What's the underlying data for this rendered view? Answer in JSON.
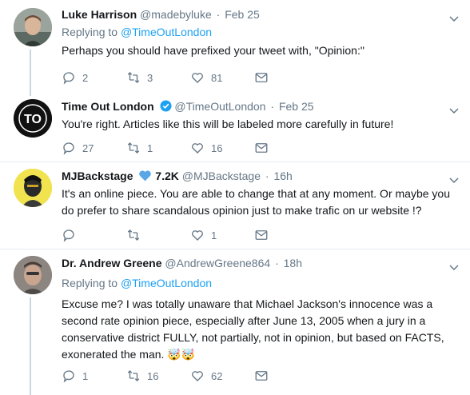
{
  "tweets": [
    {
      "name": "Luke Harrison",
      "handle": "@madebyluke",
      "time": "Feb 25",
      "replying_prefix": "Replying to",
      "replying_to": "@TimeOutLondon",
      "text": "Perhaps you should have prefixed your tweet with, \"Opinion:\"",
      "replies": "2",
      "retweets": "3",
      "likes": "81"
    },
    {
      "name": "Time Out London",
      "handle": "@TimeOutLondon",
      "time": "Feb 25",
      "verified": true,
      "avatar_text": "TO",
      "text": "You're right. Articles like this will be labeled more carefully in future!",
      "replies": "27",
      "retweets": "1",
      "likes": "16"
    },
    {
      "name": "MJBackstage",
      "badge_count": "7.2K",
      "handle": "@MJBackstage",
      "time": "16h",
      "text": "It's an online piece. You are able to change that at any moment. Or maybe you do prefer to share scandalous opinion just to make trafic on ur website !?",
      "replies": "",
      "retweets": "",
      "likes": "1"
    },
    {
      "name": "Dr. Andrew Greene",
      "handle": "@AndrewGreene864",
      "time": "18h",
      "replying_prefix": "Replying to",
      "replying_to": "@TimeOutLondon",
      "text": "Excuse me? I was totally unaware that Michael Jackson's innocence was a second rate opinion piece, especially after June 13, 2005 when a jury in a conservative district FULLY, not partially, not in opinion, but based on FACTS, exonerated the man. 🤯🤯",
      "replies": "1",
      "retweets": "16",
      "likes": "62"
    }
  ],
  "separator": "·",
  "colors": {
    "link": "#1da1f2",
    "muted": "#657786",
    "text": "#14171a",
    "border": "#e6ecf0",
    "verified": "#1da1f2",
    "heart_badge": "#5aa7e8"
  },
  "icons": [
    "reply-icon",
    "retweet-icon",
    "like-icon",
    "dm-icon",
    "chevron-down-icon",
    "verified-icon",
    "heart-icon"
  ]
}
